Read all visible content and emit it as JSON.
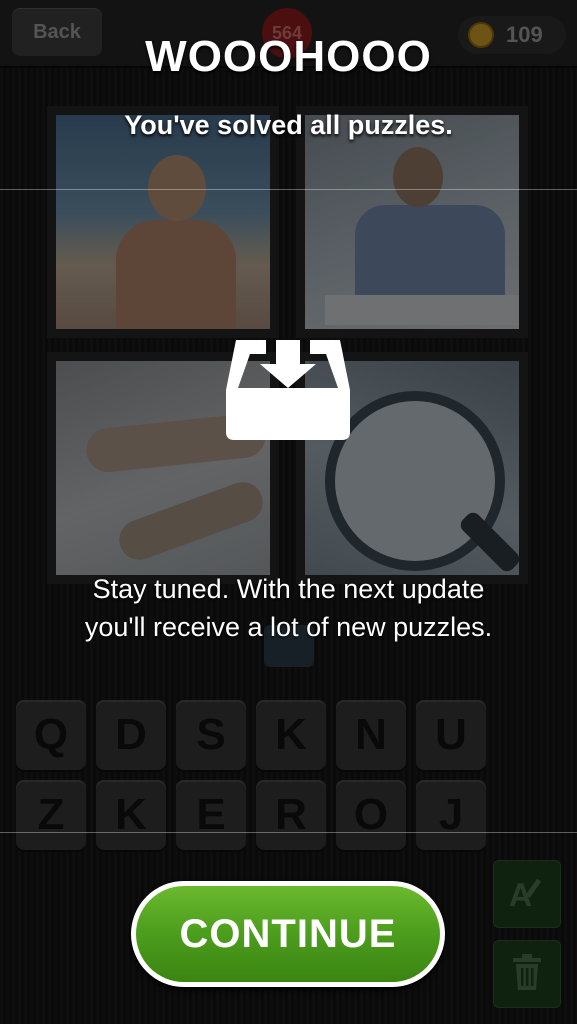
{
  "topbar": {
    "back_label": "Back",
    "level": "564",
    "coins": "109"
  },
  "overlay": {
    "title": "WOOOHOOO",
    "subtitle": "You've solved all puzzles.",
    "message_line1": "Stay tuned. With the next update",
    "message_line2": "you'll receive a lot of new puzzles.",
    "continue_label": "CONTINUE"
  },
  "keyboard": {
    "row1": [
      "Q",
      "D",
      "S",
      "K",
      "N",
      "U"
    ],
    "row2": [
      "Z",
      "K",
      "E",
      "R",
      "O",
      "J"
    ]
  },
  "icons": {
    "inbox": "inbox-download-icon",
    "coin": "coin-icon",
    "edit": "letter-a-pen-icon",
    "trash": "trash-icon"
  },
  "colors": {
    "continue_green": "#4a9a1c",
    "coin_gold": "#c99a26",
    "level_badge": "#8a1c1c"
  }
}
